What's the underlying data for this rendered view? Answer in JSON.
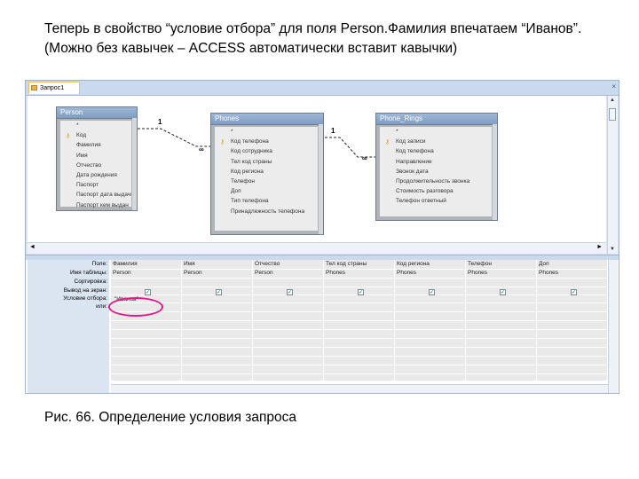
{
  "intro_text": "Теперь в свойство “условие отбора” для поля Person.Фамилия впечатаем “Иванов”. (Можно без кавычек – ACCESS автоматически вставит кавычки)",
  "caption": "Рис. 66. Определение условия запроса",
  "window": {
    "tab_label": "Запрос1",
    "close_label": "×"
  },
  "tables": {
    "person": {
      "title": "Person",
      "fields": [
        "*",
        "Код",
        "Фамилия",
        "Имя",
        "Отчество",
        "Дата рождения",
        "Паспорт",
        "Паспорт дата выдачи",
        "Паспорт кем выдан"
      ]
    },
    "phones": {
      "title": "Phones",
      "fields": [
        "*",
        "Код телефона",
        "Код сотрудника",
        "Тел код страны",
        "Код региона",
        "Телефон",
        "Доп",
        "Тип телефона",
        "Принадлежность телефона"
      ]
    },
    "phone_rings": {
      "title": "Phone_Rings",
      "fields": [
        "*",
        "Код записи",
        "Код телефона",
        "Направление",
        "Звонок дата",
        "Продолжительность звонка",
        "Стоимость разговора",
        "Телефон ответный"
      ]
    }
  },
  "relations": {
    "one": "1",
    "many": "∞"
  },
  "grid": {
    "row_labels": [
      "Поле:",
      "Имя таблицы:",
      "Сортировка:",
      "Вывод на экран:",
      "Условие отбора:",
      "или:"
    ],
    "columns": [
      {
        "field": "Фамилия",
        "table": "Person",
        "show": true,
        "criteria": "\"Иванов\""
      },
      {
        "field": "Имя",
        "table": "Person",
        "show": true,
        "criteria": ""
      },
      {
        "field": "Отчество",
        "table": "Person",
        "show": true,
        "criteria": ""
      },
      {
        "field": "Тел код страны",
        "table": "Phones",
        "show": true,
        "criteria": ""
      },
      {
        "field": "Код региона",
        "table": "Phones",
        "show": true,
        "criteria": ""
      },
      {
        "field": "Телефон",
        "table": "Phones",
        "show": true,
        "criteria": ""
      },
      {
        "field": "Доп",
        "table": "Phones",
        "show": true,
        "criteria": ""
      },
      {
        "field": "Ти",
        "table": "Ph",
        "show": true,
        "criteria": ""
      }
    ]
  },
  "colors": {
    "highlight": "#e0198a",
    "window_bg": "#dbe5f1",
    "table_title": "#7f9cc4"
  }
}
